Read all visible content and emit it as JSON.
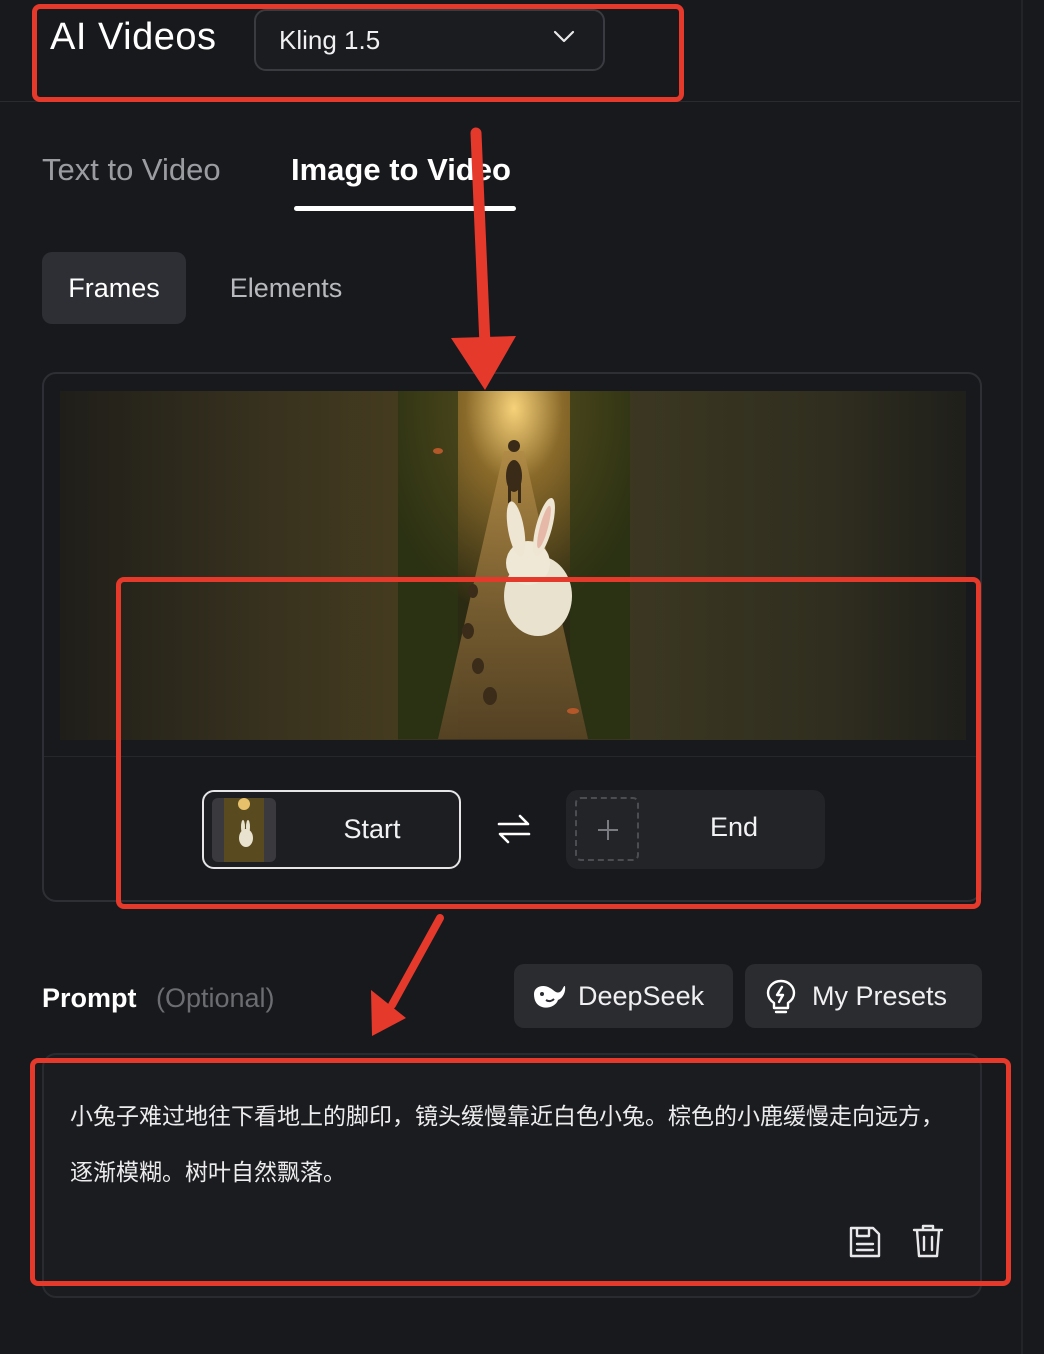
{
  "header": {
    "title": "AI Videos",
    "model_select": {
      "value": "Kling 1.5",
      "icon": "chevron-down-icon"
    }
  },
  "tabs": [
    {
      "label": "Text to Video",
      "active": false
    },
    {
      "label": "Image to Video",
      "active": true
    }
  ],
  "segments": [
    {
      "label": "Frames",
      "active": true
    },
    {
      "label": "Elements",
      "active": false
    }
  ],
  "frames": {
    "start": {
      "label": "Start",
      "has_image": true
    },
    "end": {
      "label": "End",
      "has_image": false,
      "icon": "plus-icon"
    },
    "swap_icon": "swap-arrows-icon"
  },
  "prompt": {
    "label": "Prompt",
    "optional_label": "(Optional)",
    "text": "小兔子难过地往下看地上的脚印，镜头缓慢靠近白色小兔。棕色的小鹿缓慢走向远方，逐渐模糊。树叶自然飘落。",
    "actions": [
      "save-icon",
      "trash-icon"
    ]
  },
  "buttons": {
    "deepseek": {
      "label": "DeepSeek",
      "icon": "whale-icon"
    },
    "presets": {
      "label": "My Presets",
      "icon": "lightbulb-icon"
    }
  },
  "colors": {
    "background": "#18191c",
    "annotation": "#e5392c",
    "accent_text": "#ffffff"
  }
}
